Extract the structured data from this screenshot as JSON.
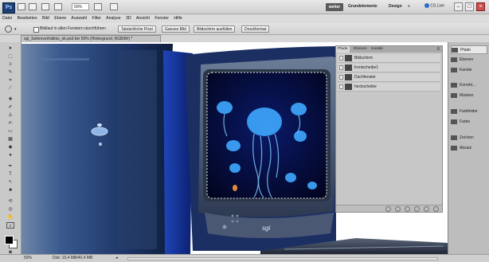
{
  "appbar": {
    "logo": "Ps",
    "zoom": "50%",
    "workspace_active": "weiter",
    "workspaces": [
      "Grundelemente",
      "Design",
      "»"
    ],
    "cs_live": "CS Live"
  },
  "menus": [
    "Datei",
    "Bearbeiten",
    "Bild",
    "Ebene",
    "Auswahl",
    "Filter",
    "Analyse",
    "3D",
    "Ansicht",
    "Fenster",
    "Hilfe"
  ],
  "options": {
    "checkbox_label": "Bildlauf in allen Fenstern durchführen",
    "buttons": [
      "Tatsächliche Pixel",
      "Ganzes Bild",
      "Bildschirm ausfüllen",
      "Druckformat"
    ]
  },
  "document": {
    "tab_title": "sgi_Seitenverhältnis_ok.psd bei 50% (Hintergrund, RGB/8#) *"
  },
  "layers_panel": {
    "tabs": [
      "Pfade",
      "Ebenen",
      "Kanäle"
    ],
    "layers": [
      "Bildschirm",
      "frontscheibe1",
      "Dachfenster",
      "heckscheibe"
    ]
  },
  "dock": {
    "items": [
      "Pfade",
      "Ebenen",
      "Kanäle",
      "Korrekt...",
      "Masken",
      "Farbfelder",
      "Farbe",
      "Zeichen",
      "Absatz"
    ]
  },
  "status": {
    "zoom": "50%",
    "doc_info": "Dok: 15,4 MB/40,4 MB"
  },
  "monitor": {
    "logo": "sgi"
  }
}
